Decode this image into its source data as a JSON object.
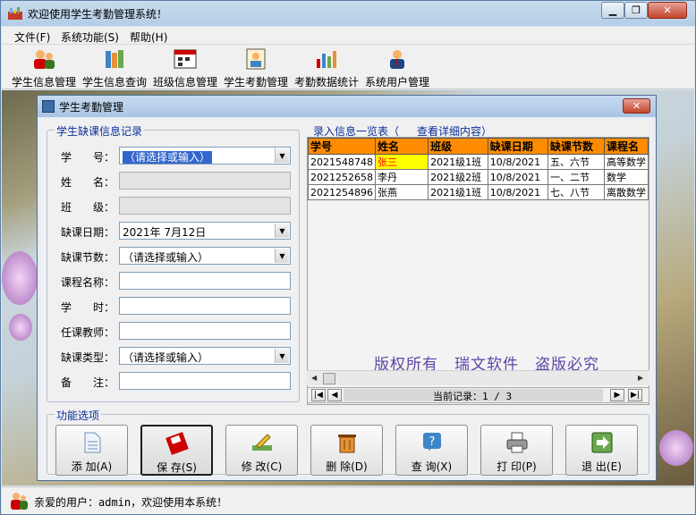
{
  "window": {
    "title": "欢迎使用学生考勤管理系统！"
  },
  "menu": [
    "文件(F)",
    "系统功能(S)",
    "帮助(H)"
  ],
  "toolbar": [
    {
      "label": "学生信息管理",
      "icon": "users-icon"
    },
    {
      "label": "学生信息查询",
      "icon": "books-icon"
    },
    {
      "label": "班级信息管理",
      "icon": "calendar-icon"
    },
    {
      "label": "学生考勤管理",
      "icon": "attendance-icon"
    },
    {
      "label": "考勤数据统计",
      "icon": "bar-chart-icon"
    },
    {
      "label": "系统用户管理",
      "icon": "user-admin-icon"
    }
  ],
  "child": {
    "title": "学生考勤管理",
    "form": {
      "legend": "学生缺课信息记录",
      "fields": [
        {
          "label": "学　　号：",
          "value": "（请选择或输入）",
          "kind": "combo",
          "selected": true
        },
        {
          "label": "姓　　名：",
          "value": "",
          "kind": "disabled"
        },
        {
          "label": "班　　级：",
          "value": "",
          "kind": "disabled"
        },
        {
          "label": "缺课日期：",
          "value": "2021年 7月12日",
          "kind": "combo"
        },
        {
          "label": "缺课节数：",
          "value": "（请选择或输入）",
          "kind": "combo"
        },
        {
          "label": "课程名称：",
          "value": "",
          "kind": "text"
        },
        {
          "label": "学　　时：",
          "value": "",
          "kind": "text"
        },
        {
          "label": "任课教师：",
          "value": "",
          "kind": "text"
        },
        {
          "label": "缺课类型：",
          "value": "（请选择或输入）",
          "kind": "combo"
        },
        {
          "label": "备　　注：",
          "value": "",
          "kind": "text"
        }
      ]
    },
    "list": {
      "legend_prefix": "录入信息一览表（",
      "legend_suffix": "查看详细内容）",
      "columns": [
        "学号",
        "姓名",
        "班级",
        "缺课日期",
        "缺课节数",
        "课程名"
      ],
      "rows": [
        [
          "2021548748",
          "张三",
          "2021级1班",
          "10/8/2021",
          "五、六节",
          "高等数学"
        ],
        [
          "2021252658",
          "李丹",
          "2021级2班",
          "10/8/2021",
          "一、二节",
          "数学"
        ],
        [
          "2021254896",
          "张燕",
          "2021级1班",
          "10/8/2021",
          "七、八节",
          "离散数学"
        ]
      ],
      "highlight_color": "#ffff00",
      "header_color": "#ff8c00"
    },
    "watermark": "版权所有　瑞文软件　盗版必究",
    "navigator": {
      "text": "当前记录：1 / 3"
    },
    "functions": {
      "legend": "功能选项",
      "buttons": [
        {
          "label": "添 加(A)",
          "icon": "document-icon"
        },
        {
          "label": "保 存(S)",
          "icon": "floppy-disk-icon"
        },
        {
          "label": "修 改(C)",
          "icon": "edit-icon"
        },
        {
          "label": "删 除(D)",
          "icon": "trash-icon"
        },
        {
          "label": "查 询(X)",
          "icon": "help-query-icon"
        },
        {
          "label": "打 印(P)",
          "icon": "printer-icon"
        },
        {
          "label": "退 出(E)",
          "icon": "exit-arrow-icon"
        }
      ]
    }
  },
  "status": {
    "text": "亲爱的用户：admin，欢迎使用本系统！"
  }
}
